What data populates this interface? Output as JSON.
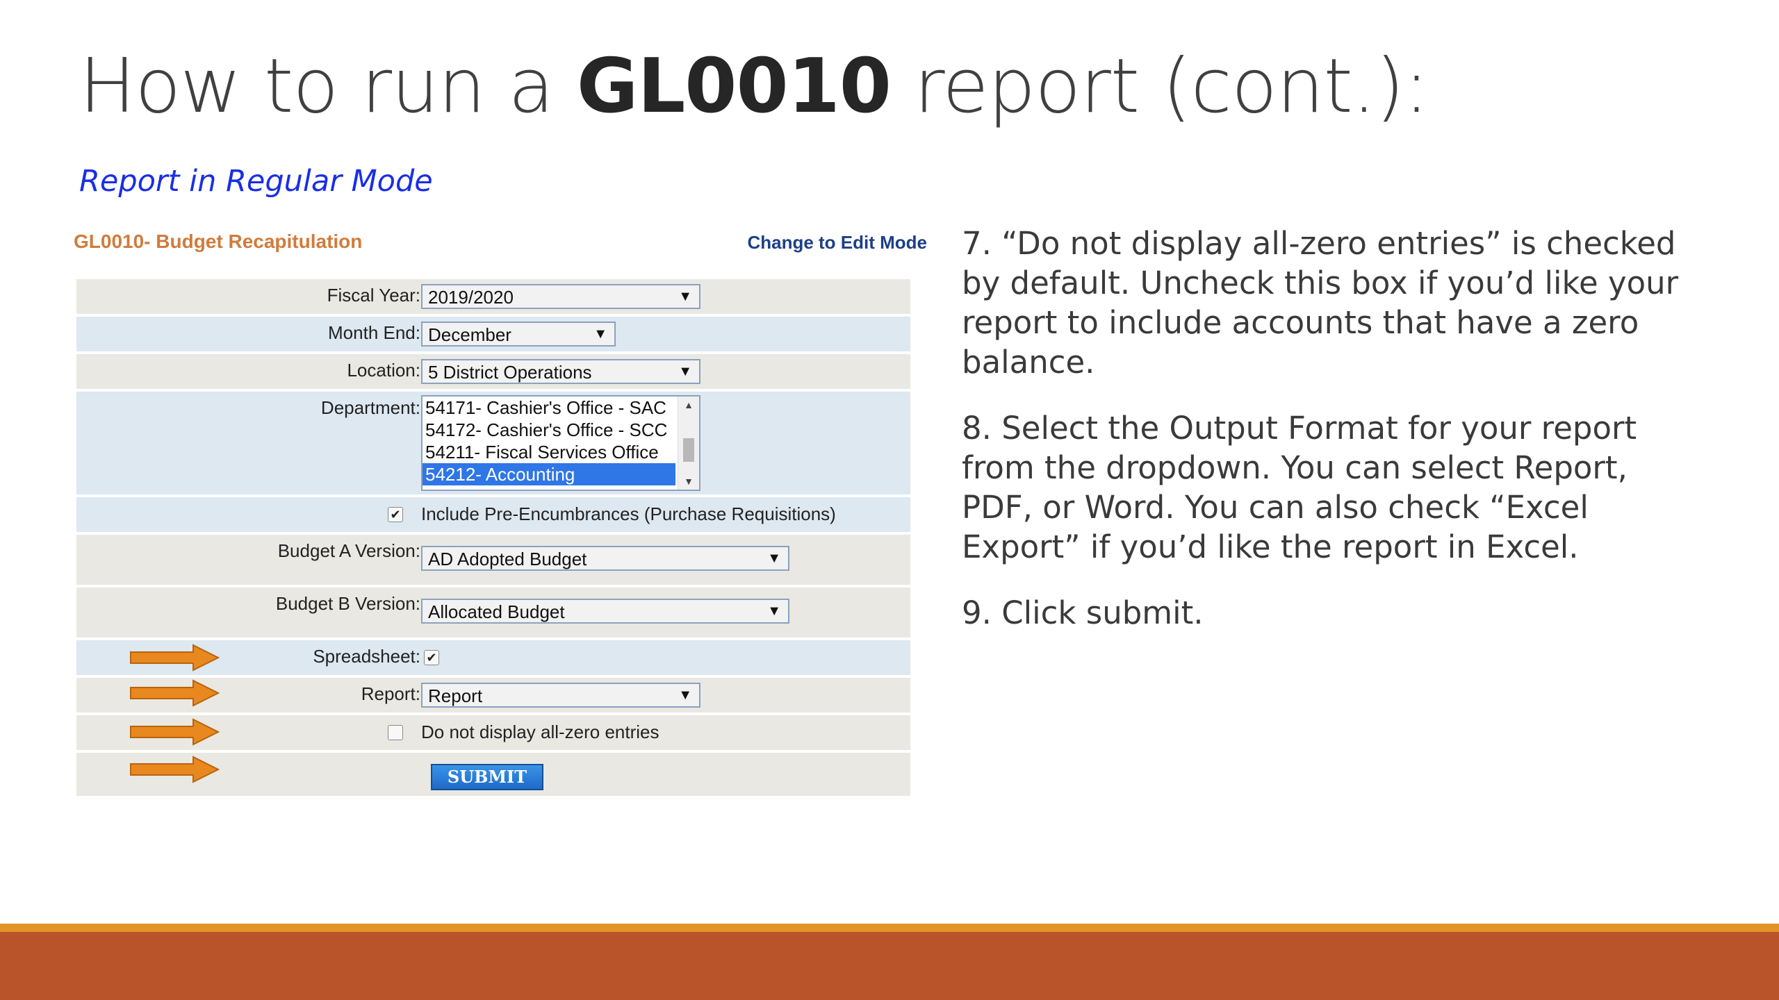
{
  "slide": {
    "title_prefix": "How to run a ",
    "title_bold": "GL0010",
    "title_suffix": " report (cont.):",
    "subtitle": "Report in Regular Mode"
  },
  "form": {
    "title": "GL0010- Budget Recapitulation",
    "edit_link": "Change to Edit Mode",
    "fiscal_year": {
      "label": "Fiscal Year:",
      "value": "2019/2020"
    },
    "month_end": {
      "label": "Month End:",
      "value": "December"
    },
    "location": {
      "label": "Location:",
      "value": "5 District Operations"
    },
    "department": {
      "label": "Department:",
      "options": [
        "54171- Cashier's Office - SAC",
        "54172- Cashier's Office - SCC",
        "54211- Fiscal Services Office",
        "54212- Accounting"
      ],
      "selected": "54212- Accounting"
    },
    "pre_encumbrances": {
      "label": "Include Pre-Encumbrances (Purchase Requisitions)",
      "checked": true,
      "mark": "✔"
    },
    "budget_a": {
      "label": "Budget A Version:",
      "value": "AD Adopted Budget"
    },
    "budget_b": {
      "label": "Budget B Version:",
      "value": "Allocated Budget"
    },
    "spreadsheet": {
      "label": "Spreadsheet:",
      "checked": true,
      "mark": "✔"
    },
    "report": {
      "label": "Report:",
      "value": "Report"
    },
    "zero_entries": {
      "label": "Do not display all-zero entries",
      "checked": false
    },
    "submit_label": "SUBMIT",
    "arrow_color": "#e8881e"
  },
  "instructions": {
    "step7": "7. “Do not display all-zero entries” is checked by default.  Uncheck this box if you’d like your report to include accounts that have a zero balance.",
    "step8": "8. Select the Output Format for your report from the dropdown.  You can select Report, PDF, or Word.  You can also check “Excel Export” if you’d like the report in Excel.",
    "step9": "9. Click submit."
  },
  "colors": {
    "title_orange": "#d07c3c",
    "subtitle_blue": "#1a2ee6",
    "footer_line": "#e39426",
    "footer_band": "#b9532a",
    "selected_row": "#2f76e6"
  }
}
